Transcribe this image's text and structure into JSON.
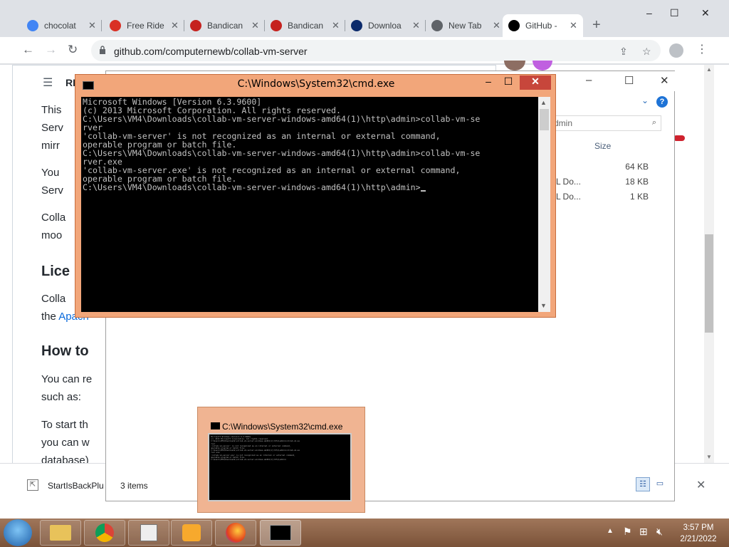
{
  "browser": {
    "tabs": [
      {
        "title": "chocolat",
        "icon": "google-icon",
        "color": "#4285f4"
      },
      {
        "title": "Free Ride",
        "icon": "free-ride-icon",
        "color": "#d93025"
      },
      {
        "title": "Bandican",
        "icon": "bandicam-icon",
        "color": "#c5221f"
      },
      {
        "title": "Bandican",
        "icon": "bandicam-icon",
        "color": "#c5221f"
      },
      {
        "title": "Downloa",
        "icon": "photoshop-icon",
        "color": "#0b2a6b"
      },
      {
        "title": "New Tab",
        "icon": "chrome-icon",
        "color": "#5f6368"
      },
      {
        "title": "GitHub -",
        "icon": "github-icon",
        "color": "#000000"
      }
    ],
    "url": "github.com/computernewb/collab-vm-server"
  },
  "readme": {
    "toc_label": "RE",
    "p1": [
      "This",
      "Serv",
      "mirr"
    ],
    "p2": [
      "You",
      "Serv"
    ],
    "p3": [
      "Colla",
      "moo"
    ],
    "heading1": "Lice",
    "p4": [
      "Colla",
      "the"
    ],
    "p4_link": "Apach",
    "heading2": "How to",
    "p5": [
      "You can re",
      "such as:"
    ],
    "p6": [
      "To start th",
      "you can w",
      "database)"
    ]
  },
  "download_bar": {
    "item": "StartIsBackPlu"
  },
  "explorer": {
    "search_placeholder": "dmin",
    "size_header": "Size",
    "files": [
      {
        "type": "e",
        "size": "64 KB"
      },
      {
        "type": "ML Do...",
        "size": "18 KB"
      },
      {
        "type": "ML Do...",
        "size": "1 KB"
      }
    ],
    "status": "3 items"
  },
  "cmd": {
    "title": "C:\\Windows\\System32\\cmd.exe",
    "lines": [
      "Microsoft Windows [Version 6.3.9600]",
      "(c) 2013 Microsoft Corporation. All rights reserved.",
      "",
      "C:\\Users\\VM4\\Downloads\\collab-vm-server-windows-amd64(1)\\http\\admin>collab-vm-se",
      "rver",
      "'collab-vm-server' is not recognized as an internal or external command,",
      "operable program or batch file.",
      "",
      "C:\\Users\\VM4\\Downloads\\collab-vm-server-windows-amd64(1)\\http\\admin>collab-vm-se",
      "rver.exe",
      "'collab-vm-server.exe' is not recognized as an internal or external command,",
      "operable program or batch file.",
      "",
      "C:\\Users\\VM4\\Downloads\\collab-vm-server-windows-amd64(1)\\http\\admin>"
    ]
  },
  "preview": {
    "title": "C:\\Windows\\System32\\cmd.exe"
  },
  "taskbar": {
    "time": "3:57 PM",
    "date": "2/21/2022"
  }
}
